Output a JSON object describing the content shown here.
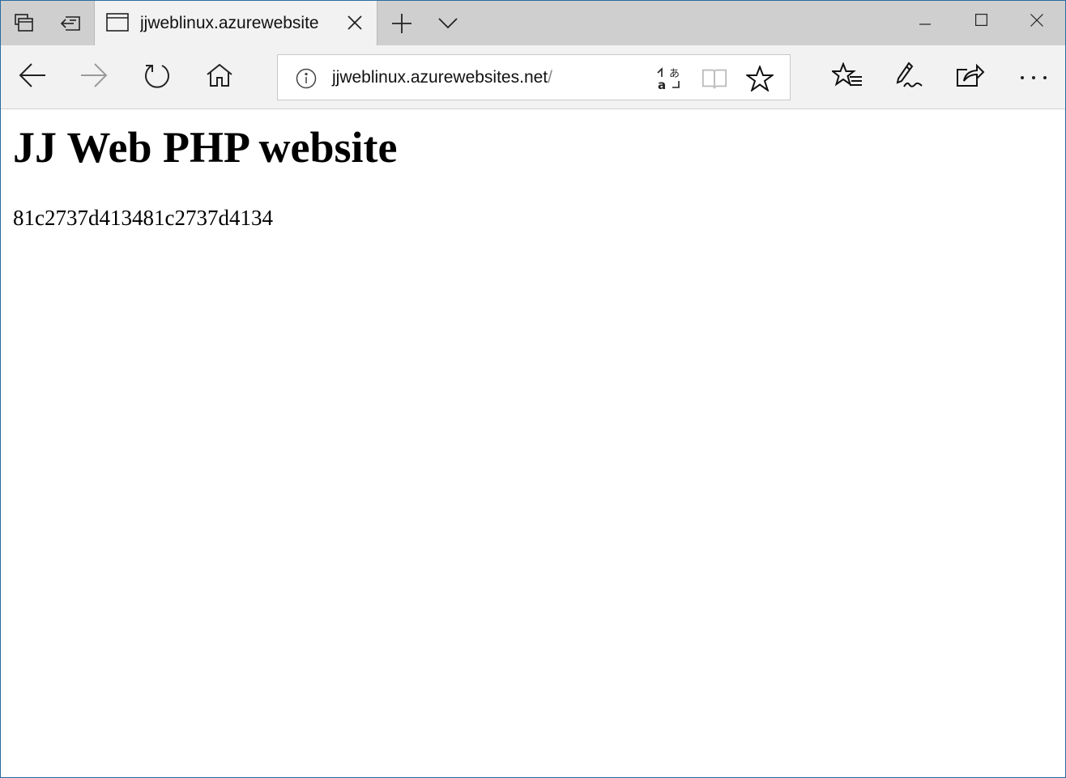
{
  "browser": {
    "tab": {
      "title": "jjweblinux.azurewebsite",
      "icon": "page-icon"
    },
    "tab_strip_icons": [
      "tabs-aside-icon",
      "set-tabs-aside-icon",
      "new-tab-icon",
      "tab-list-chevron-icon"
    ],
    "window_controls": [
      "minimize-icon",
      "maximize-icon",
      "close-icon"
    ],
    "address_bar": {
      "url_host": "jjweblinux.azurewebsites.net",
      "url_path": "/",
      "icons": [
        "site-info-icon",
        "translate-icon",
        "reading-view-icon",
        "favorite-star-icon"
      ]
    },
    "toolbar_icons": [
      "back-icon",
      "forward-icon",
      "refresh-icon",
      "home-icon",
      "favorites-hub-icon",
      "web-notes-icon",
      "share-icon",
      "more-icon"
    ],
    "colors": {
      "tabstrip_bg": "#cfcfcf",
      "active_tab_bg": "#f2f2f2",
      "toolbar_bg": "#f2f2f2",
      "window_border": "#2b6aa0"
    }
  },
  "page": {
    "heading": "JJ Web PHP website",
    "text": "81c2737d413481c2737d4134"
  }
}
